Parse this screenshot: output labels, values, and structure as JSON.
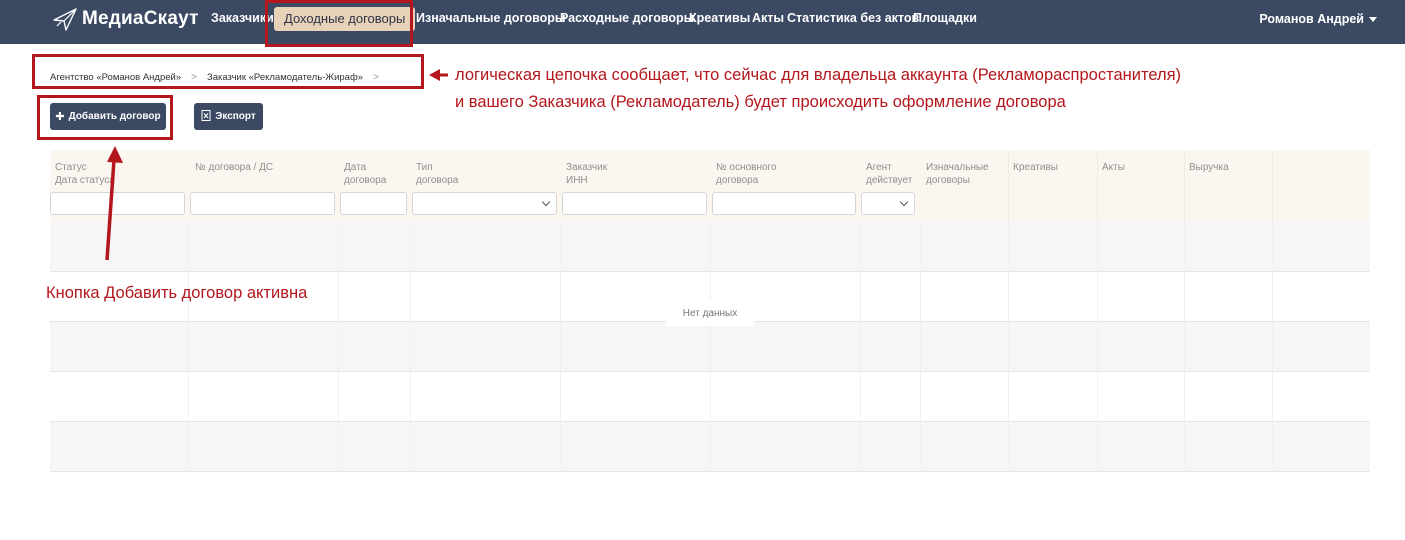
{
  "nav": {
    "brand": "МедиаСкаут",
    "items": [
      "Заказчики",
      "Доходные договоры",
      "Изначальные договоры",
      "Расходные договоры",
      "Креативы",
      "Акты",
      "Статистика без актов",
      "Площадки"
    ],
    "active_index": 1,
    "user": "Романов Андрей"
  },
  "breadcrumb": {
    "items": [
      "Агентство «Романов Андрей»",
      "Заказчик «Рекламодатель-Жираф»"
    ],
    "separator": ">"
  },
  "toolbar": {
    "add_label": "Добавить договор",
    "export_label": "Экспорт"
  },
  "table": {
    "columns": [
      {
        "line1": "Статус",
        "line2": "Дата статуса",
        "filter": "text"
      },
      {
        "line1": "№ договора / ДС",
        "line2": "",
        "filter": "text"
      },
      {
        "line1": "Дата",
        "line2": "договора",
        "filter": "text"
      },
      {
        "line1": "Тип",
        "line2": "договора",
        "filter": "select"
      },
      {
        "line1": "Заказчик",
        "line2": "ИНН",
        "filter": "text"
      },
      {
        "line1": "№ основного",
        "line2": "договора",
        "filter": "text"
      },
      {
        "line1": "Агент",
        "line2": "действует",
        "filter": "select"
      },
      {
        "line1": "Изначальные",
        "line2": "договоры",
        "filter": "none"
      },
      {
        "line1": "Креативы",
        "line2": "",
        "filter": "none"
      },
      {
        "line1": "Акты",
        "line2": "",
        "filter": "none"
      },
      {
        "line1": "Выручка",
        "line2": "",
        "filter": "none"
      }
    ],
    "empty_text": "Нет данных"
  },
  "annotations": {
    "breadcrumb_note_line1": "логическая цепочка сообщает, что сейчас для владельца аккаунта (Рекламораспростанителя)",
    "breadcrumb_note_line2": "и вашего Заказчика (Рекламодатель) будет происходить оформление договора",
    "button_note": "Кнопка Добавить договор активна",
    "color": "#b3161c"
  },
  "colors": {
    "navbar": "#3b4963",
    "active_tab": "#e8d2b8",
    "table_header": "#fbf6f0"
  }
}
